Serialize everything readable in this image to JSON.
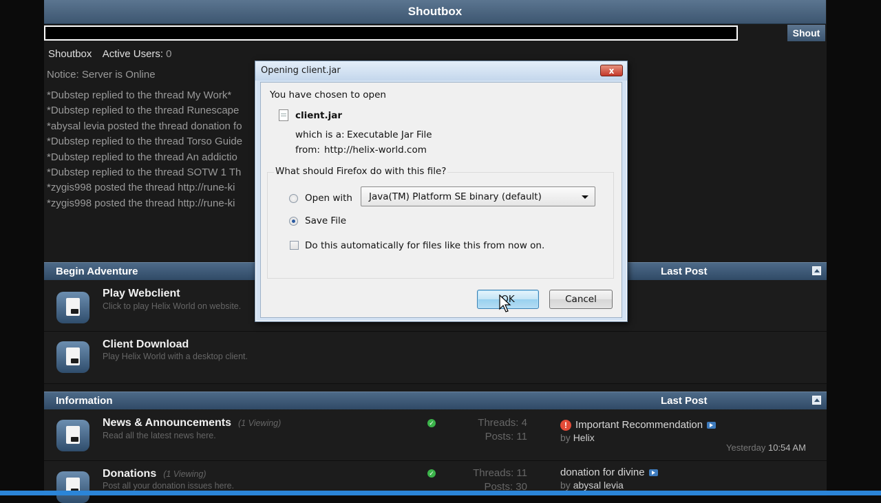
{
  "shoutbox": {
    "header": "Shoutbox",
    "shout_button": "Shout",
    "tab_label": "Shoutbox",
    "active_users_label": "Active Users:",
    "active_users_count": "0",
    "notice": "Notice: Server is Online",
    "messages": [
      "*Dubstep replied to the thread My Work*",
      "*Dubstep replied to the thread Runescape",
      "*abysal levia posted the thread donation fo",
      "*Dubstep replied to the thread Torso Guide",
      "*Dubstep replied to the thread An addictio",
      "*Dubstep replied to the thread SOTW 1 Th",
      "*zygis998 posted the thread http://rune-ki",
      "*zygis998 posted the thread http://rune-ki"
    ]
  },
  "begin": {
    "title": "Begin Adventure",
    "last_post": "Last Post",
    "forums": [
      {
        "title": "Play Webclient",
        "desc": "Click to play Helix World on website."
      },
      {
        "title": "Client Download",
        "desc": "Play Helix World with a desktop client."
      }
    ]
  },
  "information": {
    "title": "Information",
    "last_post": "Last Post",
    "forums": [
      {
        "title": "News & Announcements",
        "viewing": "(1 Viewing)",
        "desc": "Read all the latest news here.",
        "threads": "Threads: 4",
        "posts": "Posts: 11",
        "lp_title": "Important Recommendation",
        "lp_by": "by",
        "lp_user": "Helix",
        "lp_date": "Yesterday",
        "lp_time": "10:54 AM"
      },
      {
        "title": "Donations",
        "viewing": "(1 Viewing)",
        "desc": "Post all your donation issues here.",
        "threads": "Threads: 11",
        "posts": "Posts: 30",
        "lp_title": "donation for divine",
        "lp_by": "by",
        "lp_user": "abysal levia"
      }
    ]
  },
  "dialog": {
    "title": "Opening client.jar",
    "close_glyph": "x",
    "chosen_text": "You have chosen to open",
    "filename": "client.jar",
    "which_is_label": "which is a:",
    "file_type": "Executable Jar File",
    "from_label": "from:",
    "from_value": "http://helix-world.com",
    "question": "What should Firefox do with this file?",
    "open_with_label": "Open with",
    "open_with_app": "Java(TM) Platform SE binary (default)",
    "save_file_label": "Save File",
    "auto_label": "Do this automatically for files like this from now on.",
    "ok_label": "OK",
    "cancel_label": "Cancel",
    "selected_option": "Save File",
    "auto_checked": false
  }
}
